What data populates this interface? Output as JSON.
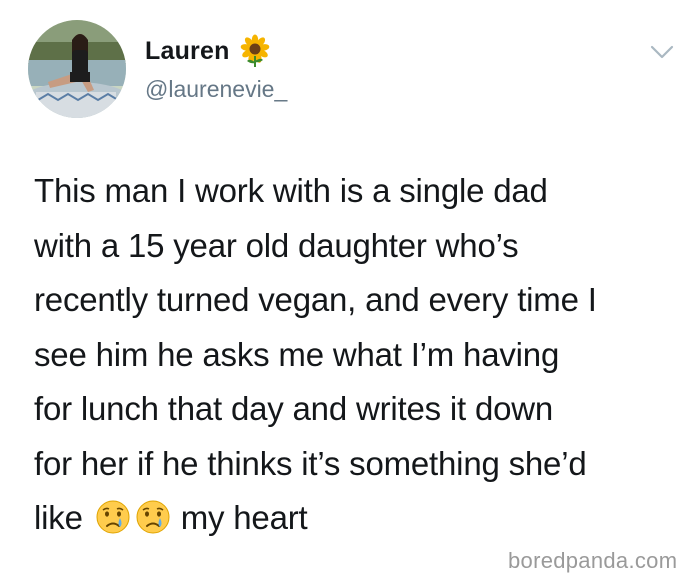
{
  "tweet": {
    "author": {
      "display_name": "Lauren",
      "name_emoji": "sunflower-icon",
      "handle": "@laurenevie_"
    },
    "menu_icon": "chevron-down-icon",
    "text_lines": [
      "This man I work with is a single dad",
      "with a 15 year old daughter who’s",
      "recently turned vegan, and every time I",
      "see him he asks me what I’m having",
      "for lunch that day and writes it down",
      "for her if he thinks it’s something she’d"
    ],
    "last_line": {
      "before": "like",
      "emojis": [
        "crying-face-icon",
        "crying-face-icon"
      ],
      "after": "my heart"
    }
  },
  "watermark": "boredpanda.com",
  "colors": {
    "text": "#14171a",
    "secondary": "#657786",
    "watermark": "#9a9a9a",
    "background": "#ffffff"
  }
}
